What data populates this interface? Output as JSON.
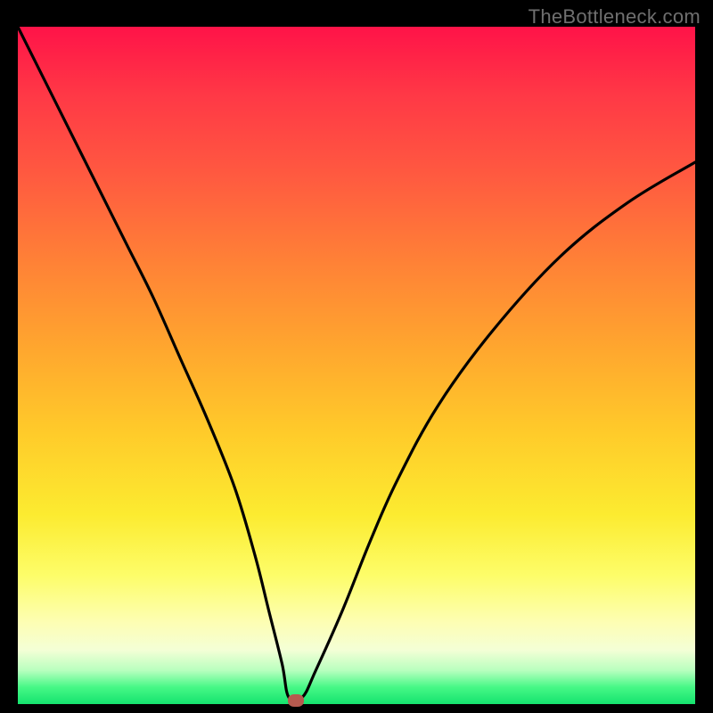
{
  "watermark": "TheBottleneck.com",
  "chart_data": {
    "type": "line",
    "title": "",
    "xlabel": "",
    "ylabel": "",
    "xlim": [
      0,
      100
    ],
    "ylim": [
      0,
      100
    ],
    "grid": false,
    "legend": false,
    "background_gradient": {
      "top": "#ff1348",
      "bottom": "#14e36e",
      "note": "vertical rainbow gradient red→orange→yellow→green"
    },
    "series": [
      {
        "name": "bottleneck-curve",
        "color": "#000000",
        "x": [
          0,
          4,
          8,
          12,
          16,
          20,
          24,
          28,
          32,
          35,
          37,
          39,
          40,
          42,
          44,
          48,
          52,
          56,
          62,
          70,
          80,
          90,
          100
        ],
        "y": [
          100,
          92,
          84,
          76,
          68,
          60,
          51,
          42,
          32,
          22,
          14,
          6,
          1,
          1,
          5,
          14,
          24,
          33,
          44,
          55,
          66,
          74,
          80
        ]
      }
    ],
    "marker": {
      "name": "current-point",
      "x": 41,
      "y": 0.5,
      "color": "#b65a4f"
    }
  }
}
